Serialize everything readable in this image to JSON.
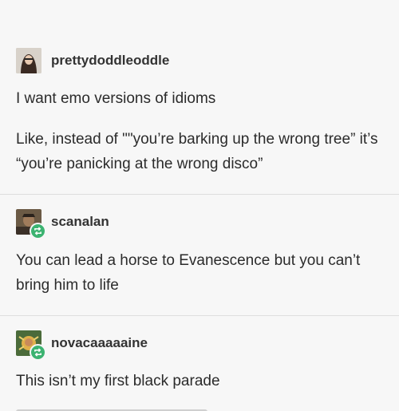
{
  "posts": [
    {
      "username": "prettydoddleoddle",
      "avatar_icon": "user-avatar-icon",
      "paragraphs": [
        "I want emo versions of idioms",
        "Like, instead of \"\"you’re barking up the wrong tree” it’s “you’re panicking at the wrong disco”"
      ]
    },
    {
      "username": "scanalan",
      "avatar_icon": "user-avatar-icon",
      "badge_icon": "reblog-icon",
      "paragraphs": [
        "You can lead a horse to Evanescence but you can’t bring him to life"
      ]
    },
    {
      "username": "novacaaaaaine",
      "avatar_icon": "user-avatar-icon",
      "badge_icon": "reblog-icon",
      "paragraphs": [
        "This isn’t my first black parade"
      ]
    }
  ],
  "colors": {
    "background": "#f7f7f7",
    "reblog_badge": "#3cb371",
    "divider": "#dedede"
  }
}
